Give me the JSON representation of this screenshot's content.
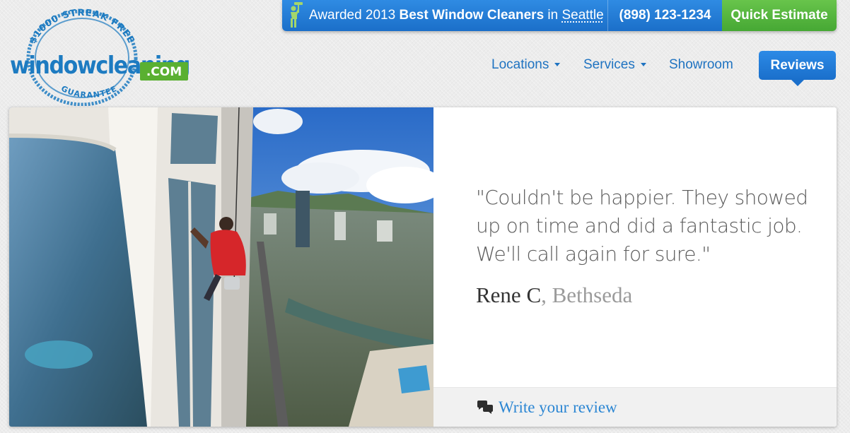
{
  "logo": {
    "arc_top": "$1000 STREAK FREE",
    "arc_bottom": "GUARANTEE",
    "wordmark": "windowcleaning",
    "tld": ".COM",
    "colors": {
      "blue": "#1d7bc1",
      "green": "#5ab031"
    }
  },
  "topbar": {
    "award_prefix": "Awarded 2013",
    "award_bold": "Best Window Cleaners",
    "award_in": "in",
    "award_city": "Seattle",
    "phone": "(898) 123-1234",
    "cta_label": "Quick Estimate",
    "colors": {
      "blue": "#2382d8",
      "green": "#57b63f"
    }
  },
  "nav": {
    "items": [
      {
        "label": "Locations",
        "has_dropdown": true
      },
      {
        "label": "Services",
        "has_dropdown": true
      },
      {
        "label": "Showroom",
        "has_dropdown": false
      },
      {
        "label": "Reviews",
        "active": true
      }
    ]
  },
  "review": {
    "image_icon": "photo-window-washer-on-skyscraper",
    "quote": "\"Couldn't be happier. They showed up on time and did a fantastic job. We'll call again for sure.\"",
    "name": "Rene C",
    "location": ", Bethseda",
    "write_icon": "speech-bubbles-icon",
    "write_label": "Write your review"
  }
}
